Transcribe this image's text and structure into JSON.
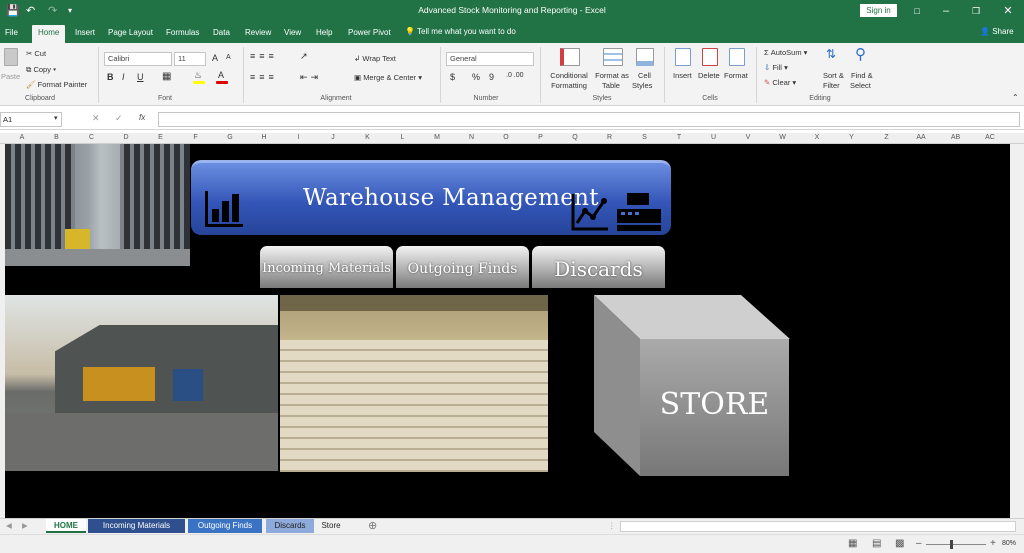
{
  "window": {
    "title": "Advanced Stock Monitoring and Reporting  -  Excel",
    "sign_in": "Sign in"
  },
  "ribbon_tabs": [
    "File",
    "Home",
    "Insert",
    "Page Layout",
    "Formulas",
    "Data",
    "Review",
    "View",
    "Help",
    "Power Pivot"
  ],
  "tell_me": "Tell me what you want to do",
  "share": "Share",
  "clipboard": {
    "paste": "Paste",
    "cut": "Cut",
    "copy": "Copy",
    "format_painter": "Format Painter",
    "group": "Clipboard"
  },
  "font": {
    "name": "Calibri",
    "size": "11",
    "group": "Font",
    "bold": "B",
    "italic": "I",
    "underline": "U",
    "grow": "A",
    "shrink": "A"
  },
  "alignment": {
    "wrap": "Wrap Text",
    "merge": "Merge & Center",
    "group": "Alignment"
  },
  "number": {
    "format": "General",
    "currency": "$",
    "percent": "%",
    "comma": "9",
    "group": "Number"
  },
  "styles": {
    "conditional": "Conditional",
    "conditional2": "Formatting",
    "format_table": "Format as",
    "format_table2": "Table",
    "cell_styles": "Cell",
    "cell_styles2": "Styles",
    "group": "Styles"
  },
  "cells": {
    "insert": "Insert",
    "delete": "Delete",
    "format": "Format",
    "group": "Cells"
  },
  "editing": {
    "autosum": "AutoSum",
    "fill": "Fill",
    "clear": "Clear",
    "sort": "Sort &",
    "sort2": "Filter",
    "find": "Find &",
    "find2": "Select",
    "group": "Editing"
  },
  "formula_bar": {
    "name_box": "A1",
    "fx": "fx",
    "value": ""
  },
  "columns": [
    "A",
    "B",
    "C",
    "D",
    "E",
    "F",
    "G",
    "H",
    "I",
    "J",
    "K",
    "L",
    "M",
    "N",
    "O",
    "P",
    "Q",
    "R",
    "S",
    "T",
    "U",
    "V",
    "W",
    "X",
    "Y",
    "Z",
    "AA",
    "AB",
    "AC"
  ],
  "dashboard": {
    "title": "Warehouse Management",
    "nav": [
      "Incoming Materials",
      "Outgoing Finds",
      "Discards"
    ],
    "store": "STORE"
  },
  "sheet_tabs": [
    {
      "label": "HOME",
      "color": "#ffffff",
      "text": "#217346"
    },
    {
      "label": "Incoming Materials",
      "color": "#2f4f8f",
      "text": "#ffffff"
    },
    {
      "label": "Outgoing Finds",
      "color": "#3a73c4",
      "text": "#ffffff"
    },
    {
      "label": "Discards",
      "color": "#8eaadb",
      "text": "#222222"
    },
    {
      "label": "Store",
      "color": "#f0f0f0",
      "text": "#222222"
    }
  ],
  "status": {
    "zoom": "80%"
  }
}
